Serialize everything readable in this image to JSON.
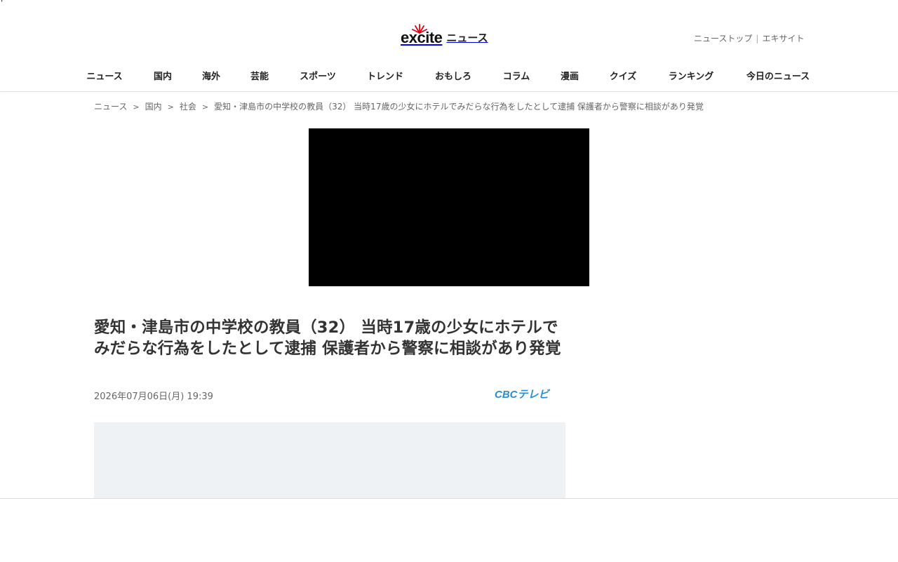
{
  "stray_text": "'",
  "header": {
    "logo_text": "excite",
    "logo_suffix": "ニュース",
    "util_links": [
      "ニューストップ",
      "エキサイト"
    ]
  },
  "nav": {
    "items": [
      "ニュース",
      "国内",
      "海外",
      "芸能",
      "スポーツ",
      "トレンド",
      "おもしろ",
      "コラム",
      "漫画",
      "クイズ",
      "ランキング",
      "今日のニュース"
    ]
  },
  "breadcrumb": {
    "items": [
      "ニュース",
      "国内",
      "社会",
      "愛知・津島市の中学校の教員（32） 当時17歳の少女にホテルでみだらな行為をしたとして逮捕 保護者から警察に相談があり発覚"
    ],
    "separator": ">"
  },
  "article": {
    "title": "愛知・津島市の中学校の教員（32） 当時17歳の少女にホテルでみだらな行為をしたとして逮捕 保護者から警察に相談があり発覚",
    "date": "2026年07月06日(月) 19:39",
    "source": "CBCテレビ"
  },
  "colors": {
    "source_logo": "#2a8fd0",
    "ad_background": "#eef2f5",
    "video_background": "#000000"
  },
  "icons": {
    "logo_mark": "excite-sunburst-icon"
  }
}
